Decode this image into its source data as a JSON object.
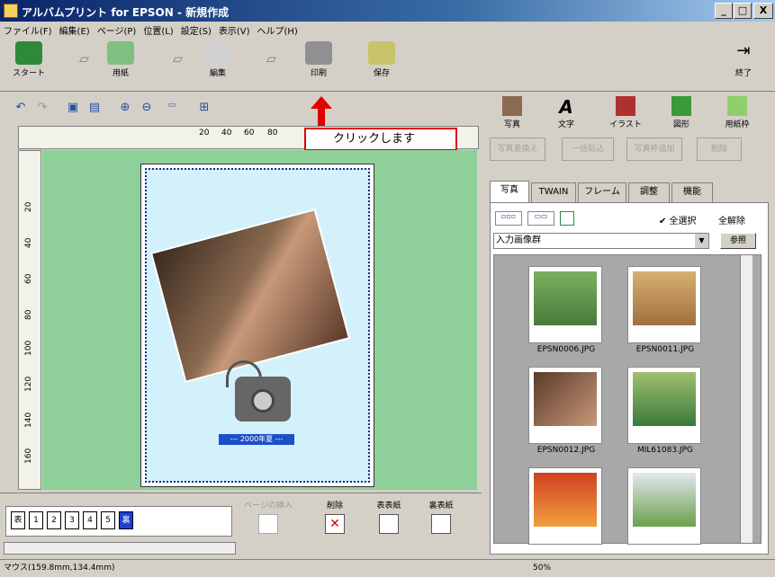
{
  "window": {
    "title": "アルバムプリント for EPSON - 新規作成",
    "min": "_",
    "max": "□",
    "close": "X"
  },
  "menu": [
    "ファイル(F)",
    "編集(E)",
    "ページ(P)",
    "位置(L)",
    "設定(S)",
    "表示(V)",
    "ヘルプ(H)"
  ],
  "toolbar": {
    "start": "スタート",
    "paper": "用紙",
    "edit": "編集",
    "print": "印刷",
    "save": "保存",
    "exit": "終了"
  },
  "ruler": {
    "ticks": [
      "20",
      "40",
      "60",
      "80"
    ]
  },
  "vruler": {
    "ticks": [
      "20",
      "40",
      "60",
      "80",
      "100",
      "120",
      "140",
      "160"
    ]
  },
  "callout": "クリックします",
  "canvas": {
    "label": "--- 2000年夏 ---"
  },
  "pages": [
    "表",
    "1",
    "2",
    "3",
    "4",
    "5",
    "裏"
  ],
  "bottom": {
    "insert": "ページの挿入",
    "delete": "削除",
    "front": "表表紙",
    "back": "裏表紙"
  },
  "right": {
    "tools": [
      "写真",
      "文字",
      "イラスト",
      "図形",
      "用紙枠"
    ],
    "gray": [
      "写真差換え",
      "一括貼込",
      "写真枠追加",
      "削除"
    ],
    "tabs": [
      "写真",
      "TWAIN",
      "フレーム",
      "調整",
      "機能"
    ],
    "view": {
      "selectall": "✔ 全選択",
      "clear": "全解除"
    },
    "select": "入力画像群",
    "ref": "参照",
    "thumbs": [
      "EPSN0006.JPG",
      "EPSN0011.JPG",
      "EPSN0012.JPG",
      "MIL61083.JPG"
    ]
  },
  "status": {
    "mouse": "マウス(159.8mm,134.4mm)",
    "zoom": "50%"
  }
}
